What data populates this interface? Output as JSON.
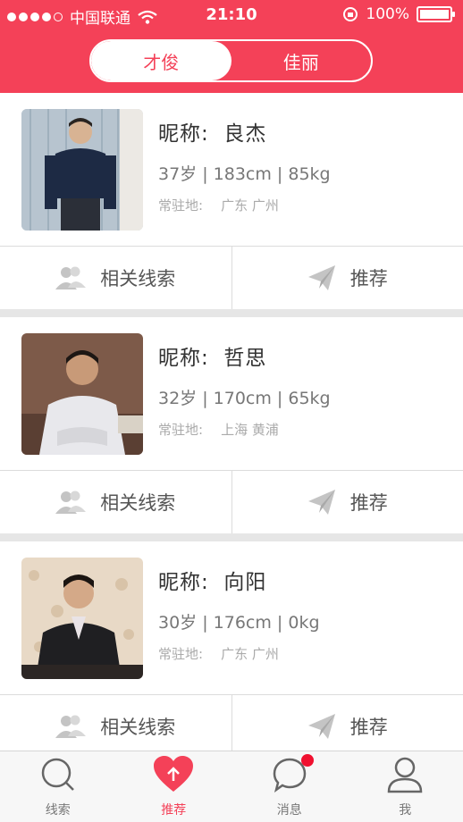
{
  "status": {
    "carrier": "中国联通",
    "time": "21:10",
    "battery": "100%"
  },
  "segment": {
    "tabs": [
      "才俊",
      "佳丽"
    ],
    "active": 0
  },
  "labels": {
    "nickname_prefix": "昵称:",
    "location_prefix": "常驻地:"
  },
  "profiles": [
    {
      "nickname": "良杰",
      "stats": "37岁 | 183cm | 85kg",
      "location": "广东 广州"
    },
    {
      "nickname": "哲思",
      "stats": "32岁 | 170cm | 65kg",
      "location": "上海 黄浦"
    },
    {
      "nickname": "向阳",
      "stats": "30岁 | 176cm | 0kg",
      "location": "广东 广州"
    }
  ],
  "actions": {
    "clues": "相关线索",
    "recommend": "推荐"
  },
  "tabbar": {
    "items": [
      {
        "label": "线索",
        "icon": "search-icon"
      },
      {
        "label": "推荐",
        "icon": "heart-icon"
      },
      {
        "label": "消息",
        "icon": "chat-bubble-icon"
      },
      {
        "label": "我",
        "icon": "person-icon"
      }
    ],
    "active": 1
  },
  "colors": {
    "brand": "#f44158",
    "badge": "#f0102f"
  }
}
